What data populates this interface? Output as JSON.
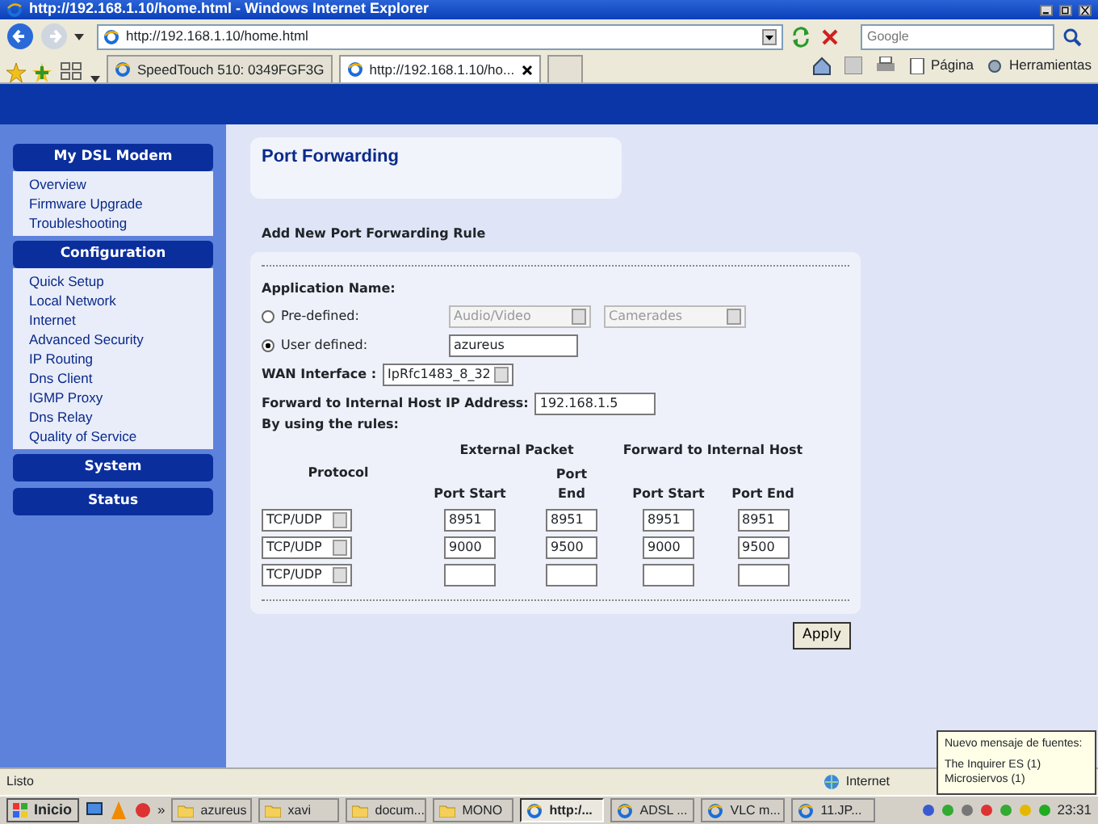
{
  "window": {
    "title": "http://192.168.1.10/home.html - Windows Internet Explorer"
  },
  "address_bar": {
    "url": "http://192.168.1.10/home.html"
  },
  "search": {
    "placeholder": "Google"
  },
  "tabs": [
    {
      "label": "SpeedTouch 510:  0349FGF3G",
      "selected": false
    },
    {
      "label": "http://192.168.1.10/ho...",
      "selected": true
    }
  ],
  "command_bar": [
    "Página",
    "Herramientas"
  ],
  "sidebar": [
    {
      "title": "My DSL Modem",
      "items": [
        "Overview",
        "Firmware Upgrade",
        "Troubleshooting"
      ]
    },
    {
      "title": "Configuration",
      "items": [
        "Quick Setup",
        "Local Network",
        "Internet",
        "Advanced Security",
        "IP Routing",
        "Dns Client",
        "IGMP Proxy",
        "Dns Relay",
        "Quality of Service"
      ]
    },
    {
      "title": "System"
    },
    {
      "title": "Status"
    }
  ],
  "page": {
    "title": "Port Forwarding",
    "subtitle": "Add New Port Forwarding Rule",
    "app_label": "Application Name:",
    "options": [
      {
        "label": "Pre-defined:",
        "selected": false,
        "kind": "dropdowns",
        "values": [
          "Audio/Video",
          "Camerades"
        ]
      },
      {
        "label": "User defined:",
        "selected": true,
        "kind": "text",
        "values": [
          "azureus"
        ]
      }
    ],
    "wan_label": "WAN Interface :",
    "wan_value": "IpRfc1483_8_32",
    "ip_label": "Forward to Internal Host IP Address:",
    "ip_value": "192.168.1.5",
    "rules_label": "By using the rules:",
    "protocol_header": "Protocol",
    "groups": [
      "External Packet",
      "Forward to Internal Host"
    ],
    "columns": [
      "Port Start",
      "Port End",
      "Port Start",
      "Port End"
    ],
    "rows": [
      {
        "protocol": "TCP/UDP",
        "ports": [
          "8951",
          "8951",
          "8951",
          "8951"
        ]
      },
      {
        "protocol": "TCP/UDP",
        "ports": [
          "9000",
          "9500",
          "9000",
          "9500"
        ]
      },
      {
        "protocol": "TCP/UDP"
      }
    ],
    "apply": "Apply"
  },
  "status_bar": {
    "text": "Listo",
    "zone": "Internet"
  },
  "notification": {
    "title": "Nuevo mensaje de fuentes:",
    "items": [
      "The Inquirer ES (1)",
      "Microsiervos (1)"
    ]
  },
  "taskbar": {
    "start": "Inicio",
    "more": "»",
    "buttons": [
      {
        "label": "azureus",
        "selected": false
      },
      {
        "label": "xavi",
        "selected": false
      },
      {
        "label": "docum...",
        "selected": false
      },
      {
        "label": "MONO",
        "selected": false
      },
      {
        "label": "http:/...",
        "selected": true
      },
      {
        "label": "ADSL ...",
        "selected": false
      },
      {
        "label": "VLC m...",
        "selected": false
      },
      {
        "label": "11.JP...",
        "selected": false
      }
    ],
    "clock": "23:31"
  }
}
